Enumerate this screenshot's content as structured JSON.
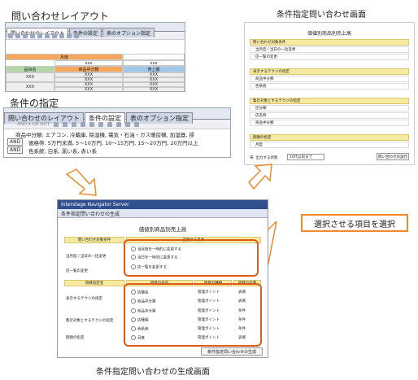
{
  "captions": {
    "layout_title": "問い合わせレイアウト",
    "screen_title": "条件指定問い合わせ画面",
    "condition_title": "条件の指定",
    "gen_screen_title": "条件指定問い合わせの生成画面",
    "callout": "選択させる項目を選択"
  },
  "layout_panel": {
    "tabs": [
      "問い合わせのレイアウト",
      "条件の設定",
      "表のオプション指定"
    ],
    "top_cell": "月度",
    "subheaders": [
      "xxx",
      "xxx"
    ],
    "col_headers": [
      "品目名",
      "商品中分類",
      "売上額"
    ],
    "rows": [
      {
        "label": "",
        "cells": [
          "XXX",
          "XXX"
        ]
      },
      {
        "label": "XXX",
        "cells": [
          "XXX",
          "XXX"
        ]
      },
      {
        "label": "",
        "cells": [
          "XXX",
          "XXX"
        ]
      },
      {
        "label": "XXX",
        "cells": [
          "XXX",
          "XXX"
        ]
      }
    ]
  },
  "condition_panel": {
    "tabs": [
      "問い合わせのレイアウト",
      "条件の設定",
      "表のオプション指定"
    ],
    "toolbar_text": "AND ▾  OR  NOT",
    "line1": "商品中分類: エアコン, 冷蔵庫, 除湿機, 電気・石油・ガス暖房機, 加湿器, 掃",
    "line2": "価格帯: 5万円未満, 5〜10万円, 10〜15万円, 15〜20万円, 20万円以上",
    "line3": "色系統: 白系, 黒い系, 赤い系",
    "and_label": "AND"
  },
  "screen_panel": {
    "title": "価値別商品別売上高",
    "sections": [
      {
        "header": "問い合わせ対象条件",
        "items": [
          "当月度 / 当日の一括変更",
          "店一覧の変更"
        ]
      },
      {
        "header": "表示するテクジの指定",
        "items": [
          "商品中分類",
          "色系統"
        ]
      },
      {
        "header": "集計対象とするテクジの指定",
        "items": [
          "店分類",
          "店名称",
          "商品中分類"
        ]
      },
      {
        "header": "期間の指定",
        "items": [
          "月度"
        ]
      }
    ],
    "footer_label": "帯: 出力する状態",
    "footer_select": "10代以前まで",
    "footer_button": "問い合わせの実行"
  },
  "gen_panel": {
    "brand": "Interstage Navigator Server",
    "subtitle": "条件指定問い合わせの生成",
    "title": "価値別商品別売上高",
    "col1_header": "問い合わせ対象条件",
    "col2_header": "変更する条件",
    "cond_rows": [
      "当月度 / 当日の一括変更",
      "店一覧の変更"
    ],
    "options": [
      "当月度を一時的に変更する",
      "当日を一時的に変更する",
      "店一覧を変更する"
    ],
    "item_headers": [
      "項目指定名",
      "項目の名前",
      "項目の種類",
      "項目の位置"
    ],
    "item_groups": [
      {
        "label": "表示するテクジの指定",
        "rows": [
          {
            "name": "店舗名",
            "kind": "管理ポイント",
            "pos": "表側"
          },
          {
            "name": "商品中分類",
            "kind": "管理ポイント",
            "pos": "表側"
          }
        ]
      },
      {
        "label": "集計対象とするテクジの指定",
        "rows": [
          {
            "name": "商品中分類",
            "kind": "管理ポイント",
            "pos": "条件"
          },
          {
            "name": "店種類",
            "kind": "管理ポイント",
            "pos": "条件"
          },
          {
            "name": "色系統",
            "kind": "管理ポイント",
            "pos": "条件"
          }
        ]
      },
      {
        "label": "期間の指定",
        "rows": [
          {
            "name": "月度",
            "kind": "管理ポイント",
            "pos": "表側"
          }
        ]
      }
    ],
    "gen_button": "条件指定問い合わせの生成"
  },
  "colors": {
    "accent": "#e05a17",
    "arrow": "#f08a2a",
    "header_blue": "#2f4f8f",
    "yellow": "#f6e9a1",
    "orange_cell": "#f7a65b",
    "blue_cell": "#9ec5ea",
    "green_cell": "#b5d7a8"
  }
}
